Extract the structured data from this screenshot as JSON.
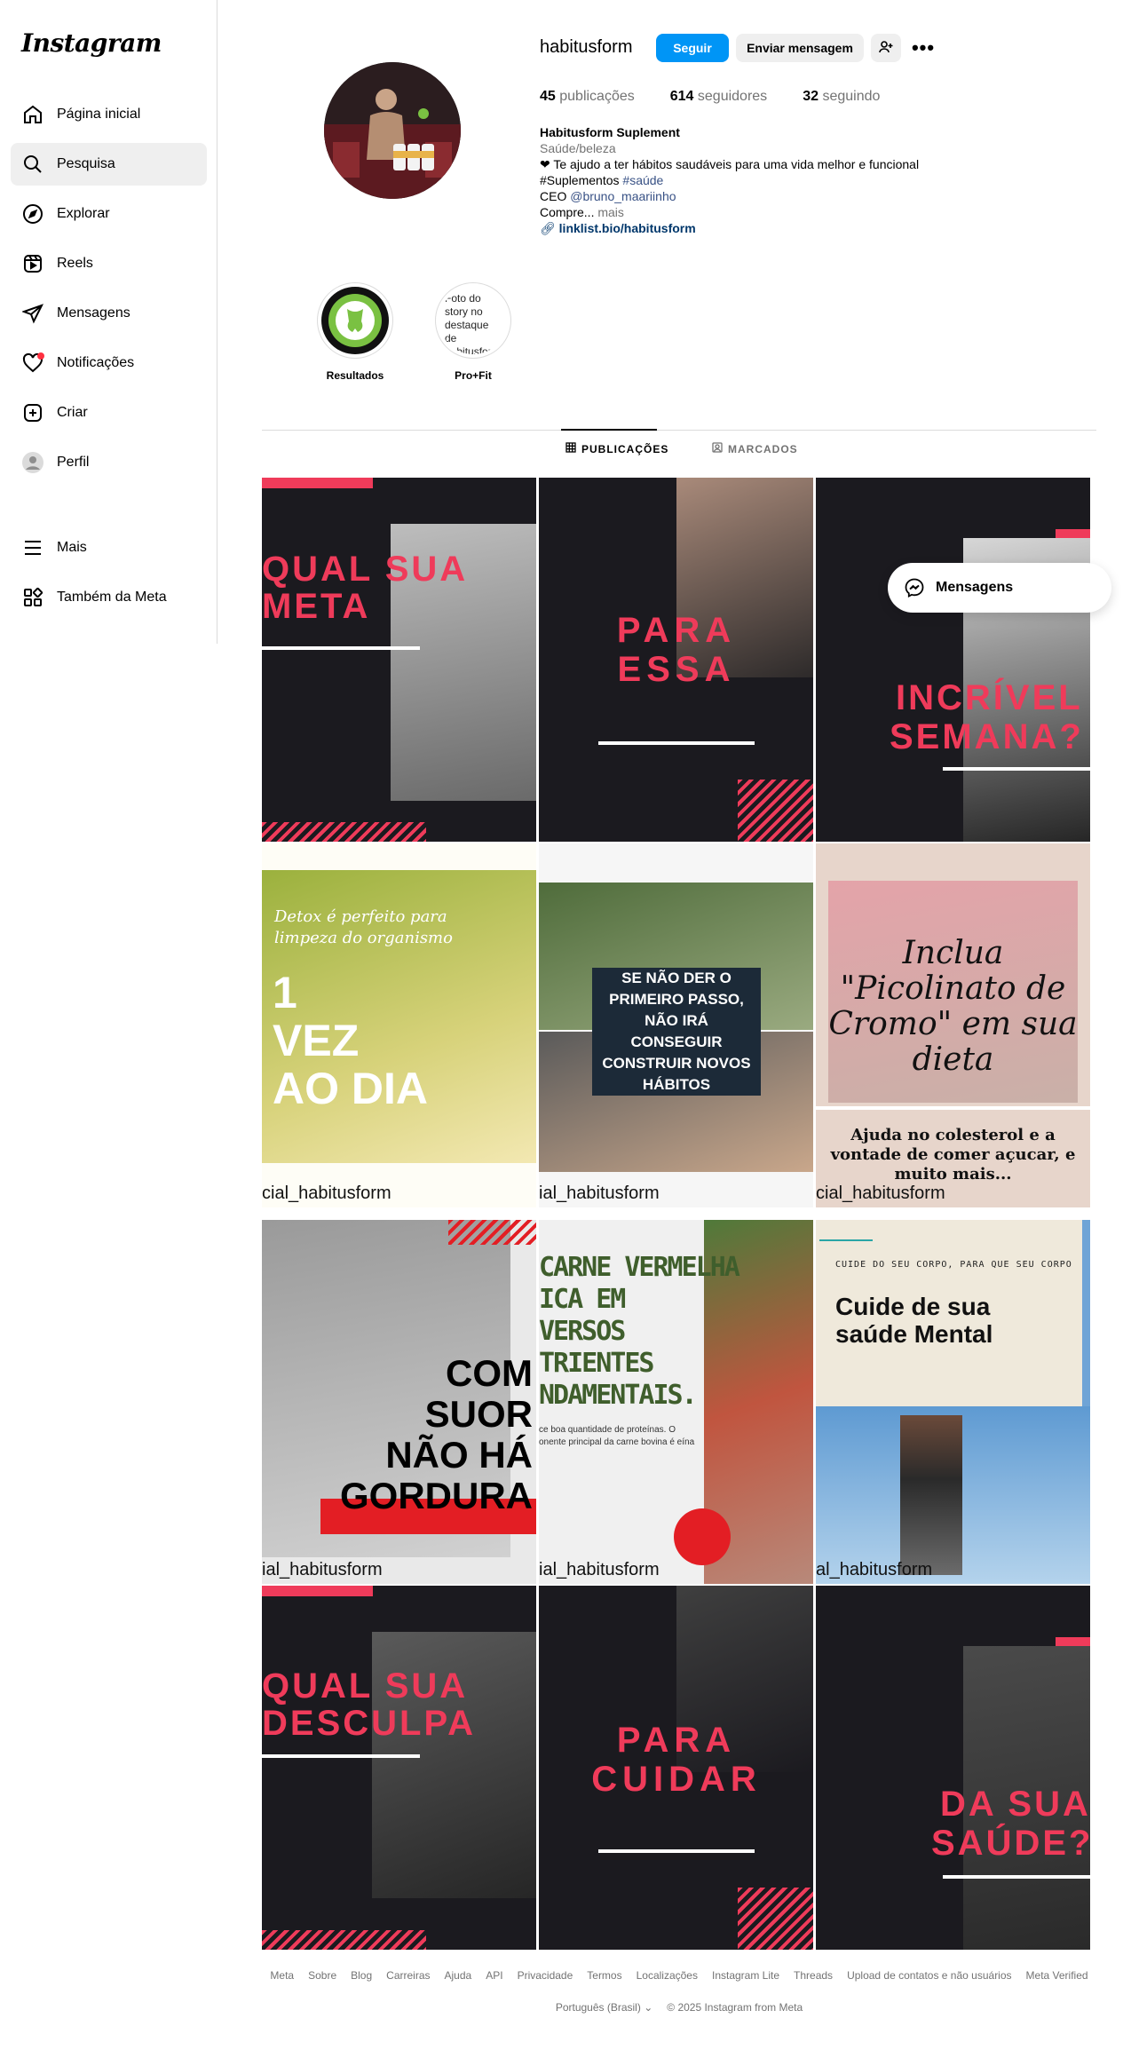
{
  "sidebar": {
    "logo": "Instagram",
    "items": [
      {
        "label": "Página inicial",
        "icon": "home-icon"
      },
      {
        "label": "Pesquisa",
        "icon": "search-icon",
        "active": true
      },
      {
        "label": "Explorar",
        "icon": "compass-icon"
      },
      {
        "label": "Reels",
        "icon": "reels-icon"
      },
      {
        "label": "Mensagens",
        "icon": "send-icon"
      },
      {
        "label": "Notificações",
        "icon": "heart-icon"
      },
      {
        "label": "Criar",
        "icon": "plus-square-icon"
      },
      {
        "label": "Perfil",
        "icon": "avatar-icon"
      }
    ],
    "more": "Mais",
    "meta": "Também da Meta"
  },
  "profile": {
    "username": "habitusform",
    "follow_label": "Seguir",
    "message_label": "Enviar mensagem",
    "stats": {
      "posts_count": "45",
      "posts_label": "publicações",
      "followers_count": "614",
      "followers_label": "seguidores",
      "following_count": "32",
      "following_label": "seguindo"
    },
    "bio": {
      "name": "Habitusform Suplement",
      "category": "Saúde/beleza",
      "line1": "❤ Te ajudo a ter hábitos saudáveis para uma vida melhor e funcional",
      "line2_text": "#Suplementos ",
      "line2_tag": "#saúde",
      "line3_text": "CEO ",
      "line3_mention": "@bruno_maariinho",
      "line4_text": "Compre... ",
      "line4_more": "mais",
      "link": "linklist.bio/habitusform"
    }
  },
  "highlights": [
    {
      "label": "Resultados"
    },
    {
      "label": "Pro+Fit",
      "alt_text": "Foto do story no destaque de habitusform"
    }
  ],
  "tabs": [
    {
      "label": "PUBLICAÇÕES",
      "active": true
    },
    {
      "label": "MARCADOS"
    }
  ],
  "posts": {
    "p1": {
      "line1": "QUAL SUA",
      "line2": "META"
    },
    "p2": {
      "line1": "PARA",
      "line2": "ESSA"
    },
    "p3": {
      "line1": "INCRÍVEL",
      "line2": "SEMANA?"
    },
    "p4": {
      "sub1": "Detox é perfeito para",
      "sub2": "limpeza do organismo",
      "l1": "1",
      "l2": "VEZ",
      "l3": "AO DIA",
      "handle": "cial_habitusform"
    },
    "p5": {
      "text": "SE NÃO DER O PRIMEIRO PASSO, NÃO IRÁ CONSEGUIR CONSTRUIR NOVOS HÁBITOS",
      "handle": "ial_habitusform"
    },
    "p6": {
      "title": "Inclua \"Picolinato de Cromo\" em sua dieta",
      "sub": "Ajuda no colesterol e a vontade de comer açucar, e muito mais...",
      "handle": "cial_habitusform"
    },
    "p7": {
      "l1": "COM",
      "l2": "SUOR",
      "l3": "NÃO HÁ",
      "l4": "GORDURA",
      "handle": "ial_habitusform"
    },
    "p8": {
      "l1": "CARNE VERMELHA",
      "l2": "ICA EM",
      "l3": "VERSOS",
      "l4": "TRIENTES",
      "l5": "NDAMENTAIS.",
      "small": "ce boa quantidade de proteínas. O onente principal da carne bovina é eína",
      "handle": "ial_habitusform"
    },
    "p9": {
      "small": "CUIDE DO SEU CORPO, PARA QUE SEU CORPO",
      "title": "Cuide de sua saúde Mental",
      "handle": "al_habitusform"
    },
    "p10": {
      "line1": "QUAL SUA",
      "line2": "DESCULPA"
    },
    "p11": {
      "line1": "PARA",
      "line2": "CUIDAR"
    },
    "p12": {
      "line1": "DA SUA",
      "line2": "SAÚDE?"
    }
  },
  "messages_pill": "Mensagens",
  "footer": {
    "links": [
      "Meta",
      "Sobre",
      "Blog",
      "Carreiras",
      "Ajuda",
      "API",
      "Privacidade",
      "Termos",
      "Localizações",
      "Instagram Lite",
      "Threads",
      "Upload de contatos e não usuários",
      "Meta Verified"
    ],
    "language": "Português (Brasil)",
    "copyright": "© 2025 Instagram from Meta"
  },
  "colors": {
    "accent": "#0095f6",
    "pink": "#ef3b5a",
    "dark": "#1b1a1f"
  }
}
